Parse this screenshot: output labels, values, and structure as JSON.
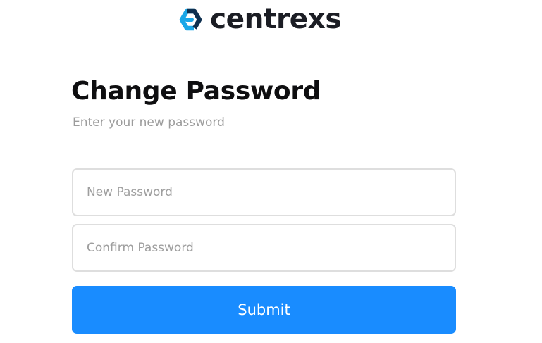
{
  "brand": {
    "name": "centrexs",
    "logo_icon": "centrexs-logo-icon",
    "logo_colors": [
      "#1aa7e8",
      "#1b1d24"
    ]
  },
  "heading": {
    "title": "Change Password",
    "subtitle": "Enter your new password"
  },
  "form": {
    "new_password": {
      "placeholder": "New Password",
      "value": ""
    },
    "confirm_password": {
      "placeholder": "Confirm Password",
      "value": ""
    },
    "submit_label": "Submit"
  },
  "colors": {
    "accent": "#198cff",
    "title": "#0e0e10",
    "muted": "#9c9c9c",
    "border": "#dedede"
  }
}
